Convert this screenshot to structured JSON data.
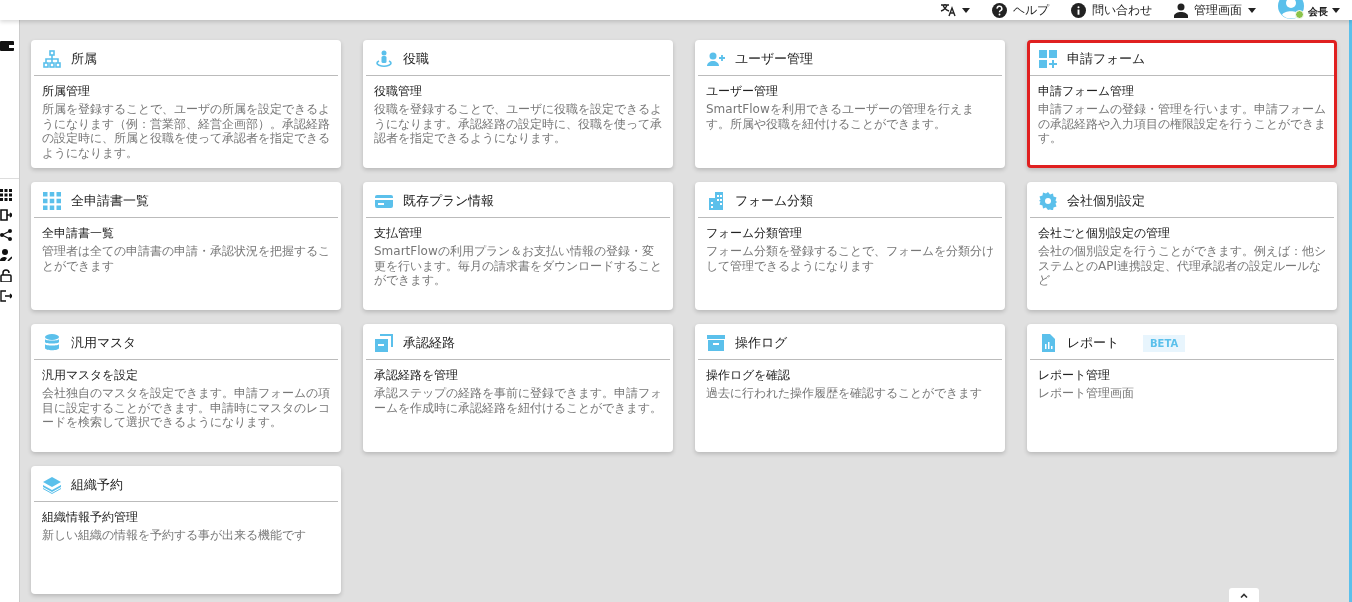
{
  "header": {
    "links": [
      {
        "kind": "help",
        "label": "ヘルプ",
        "dropdown": false
      },
      {
        "kind": "info",
        "label": "問い合わせ",
        "dropdown": false
      },
      {
        "kind": "person",
        "label": "管理画面",
        "dropdown": true
      }
    ],
    "user": {
      "role": "会長",
      "online": true
    }
  },
  "cards": [
    {
      "kind": "org",
      "title": "所属",
      "subtitle": "所属管理",
      "description": "所属を登録することで、ユーザの所属を設定できるようになります（例：営業部、経営企画部）。承認経路の設定時に、所属と役職を使って承認者を指定できるようになります。",
      "highlighted": false
    },
    {
      "kind": "person",
      "title": "役職",
      "subtitle": "役職管理",
      "description": "役職を登録することで、ユーザに役職を設定できるようになります。承認経路の設定時に、役職を使って承認者を指定できるようになります。",
      "highlighted": false
    },
    {
      "kind": "user-add",
      "title": "ユーザー管理",
      "subtitle": "ユーザー管理",
      "description": "SmartFlowを利用できるユーザーの管理を行えます。所属や役職を紐付けることができます。",
      "highlighted": false
    },
    {
      "kind": "grid-plus",
      "title": "申請フォーム",
      "subtitle": "申請フォーム管理",
      "description": "申請フォームの登録・管理を行います。申請フォームの承認経路や入力項目の権限設定を行うことができます。",
      "highlighted": true
    },
    {
      "kind": "apps",
      "title": "全申請書一覧",
      "subtitle": "全申請書一覧",
      "description": "管理者は全ての申請書の申請・承認状況を把握することができます",
      "highlighted": false
    },
    {
      "kind": "card",
      "title": "既存プラン情報",
      "subtitle": "支払管理",
      "description": "SmartFlowの利用プラン＆お支払い情報の登録・変更を行います。毎月の請求書をダウンロードすることができます。",
      "highlighted": false
    },
    {
      "kind": "building",
      "title": "フォーム分類",
      "subtitle": "フォーム分類管理",
      "description": "フォーム分類を登録することで、フォームを分類分けして管理できるようになります",
      "highlighted": false
    },
    {
      "kind": "gear",
      "title": "会社個別設定",
      "subtitle": "会社ごと個別設定の管理",
      "description": "会社の個別設定を行うことができます。例えば：他システムとのAPI連携設定、代理承認者の設定ルールなど",
      "highlighted": false
    },
    {
      "kind": "database",
      "title": "汎用マスタ",
      "subtitle": "汎用マスタを設定",
      "description": "会社独自のマスタを設定できます。申請フォームの項目に設定することができます。申請時にマスタのレコードを検索して選択できるようになります。",
      "highlighted": false
    },
    {
      "kind": "copy",
      "title": "承認経路",
      "subtitle": "承認経路を管理",
      "description": "承認ステップの経路を事前に登録できます。申請フォームを作成時に承認経路を紐付けることができます。",
      "highlighted": false
    },
    {
      "kind": "archive",
      "title": "操作ログ",
      "subtitle": "操作ログを確認",
      "description": "過去に行われた操作履歴を確認することができます",
      "highlighted": false
    },
    {
      "kind": "report",
      "title": "レポート",
      "badge": "BETA",
      "subtitle": "レポート管理",
      "description": "レポート管理画面",
      "highlighted": false
    },
    {
      "kind": "layers",
      "title": "組織予約",
      "subtitle": "組織情報予約管理",
      "description": "新しい組織の情報を予約する事が出来る機能です",
      "highlighted": false
    }
  ]
}
